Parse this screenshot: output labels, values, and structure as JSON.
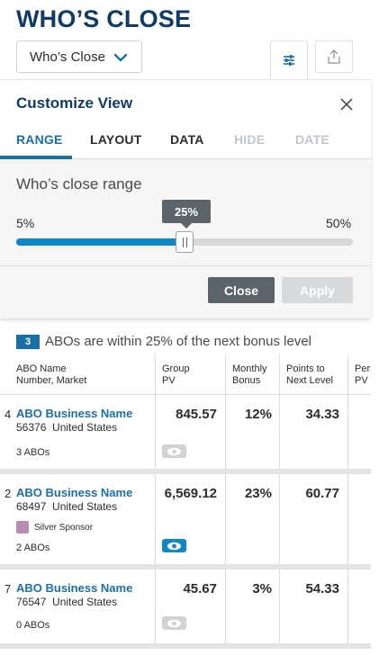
{
  "header": {
    "title": "WHO’S CLOSE",
    "view_select": "Who’s Close"
  },
  "customize": {
    "title": "Customize View",
    "tabs": [
      {
        "label": "RANGE",
        "state": "active"
      },
      {
        "label": "LAYOUT",
        "state": "normal"
      },
      {
        "label": "DATA",
        "state": "normal"
      },
      {
        "label": "HIDE",
        "state": "disabled"
      },
      {
        "label": "DATE",
        "state": "disabled"
      }
    ],
    "range_label": "Who’s close range",
    "min": "5%",
    "max": "50%",
    "value_label": "25%",
    "slider_fraction": 0.5,
    "close_label": "Close",
    "apply_label": "Apply"
  },
  "summary": {
    "count": "3",
    "text": "ABOs are within 25% of the next bonus level"
  },
  "table": {
    "columns": [
      {
        "line1": "ABO Name",
        "line2": "Number, Market"
      },
      {
        "line1": "Group",
        "line2": "PV"
      },
      {
        "line1": "Monthly",
        "line2": "Bonus"
      },
      {
        "line1": "Points to",
        "line2": "Next Level"
      },
      {
        "line1": "Pers",
        "line2": "PV"
      }
    ],
    "rows": [
      {
        "rank": "4",
        "name": "ABO Business Name",
        "number": "56376",
        "market": "United States",
        "sponsor": "",
        "abos": "3 ABOs",
        "group_pv": "845.57",
        "bonus": "12%",
        "points": "34.33",
        "eye": "off"
      },
      {
        "rank": "2",
        "name": "ABO Business Name",
        "number": "68497",
        "market": "United States",
        "sponsor": "Silver Sponsor",
        "abos": "2 ABOs",
        "group_pv": "6,569.12",
        "bonus": "23%",
        "points": "60.77",
        "eye": "on"
      },
      {
        "rank": "7",
        "name": "ABO Business Name",
        "number": "76547",
        "market": "United States",
        "sponsor": "",
        "abos": "0 ABOs",
        "group_pv": "45.67",
        "bonus": "3%",
        "points": "54.33",
        "eye": "off"
      }
    ]
  },
  "colors": {
    "brand_navy": "#0f3b66",
    "accent_blue": "#1a6fa6",
    "slider_blue": "#0f86c6",
    "sponsor_silver": "#b98cb3"
  },
  "icons": {
    "view_select": "chevron-down-icon",
    "filter": "sliders-icon",
    "share": "share-upload-icon",
    "close": "close-icon",
    "visibility": "eye-icon"
  }
}
